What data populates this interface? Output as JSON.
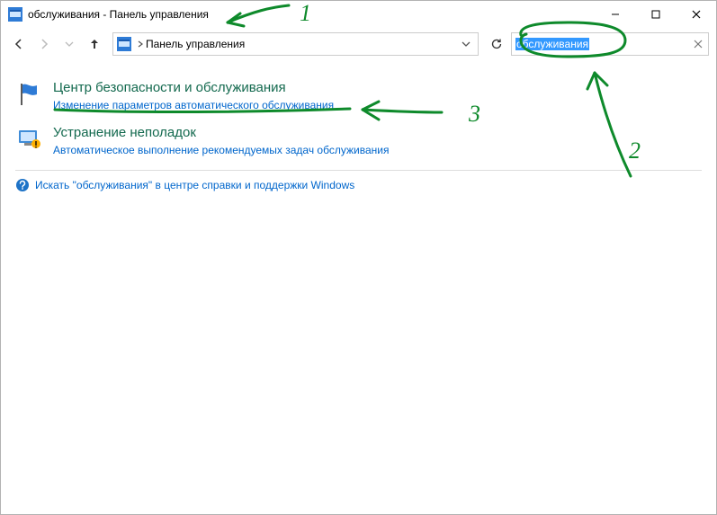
{
  "titlebar": {
    "title": "обслуживания - Панель управления"
  },
  "address": {
    "crumb1": "Панель управления"
  },
  "search": {
    "value": "обслуживания"
  },
  "results": [
    {
      "title": "Центр безопасности и обслуживания",
      "sub": "Изменение параметров автоматического обслуживания"
    },
    {
      "title": "Устранение неполадок",
      "sub": "Автоматическое выполнение рекомендуемых задач обслуживания"
    }
  ],
  "help": {
    "text": "Искать \"обслуживания\" в центре справки и поддержки Windows"
  },
  "annotations": {
    "n1": "1",
    "n2": "2",
    "n3": "3"
  }
}
